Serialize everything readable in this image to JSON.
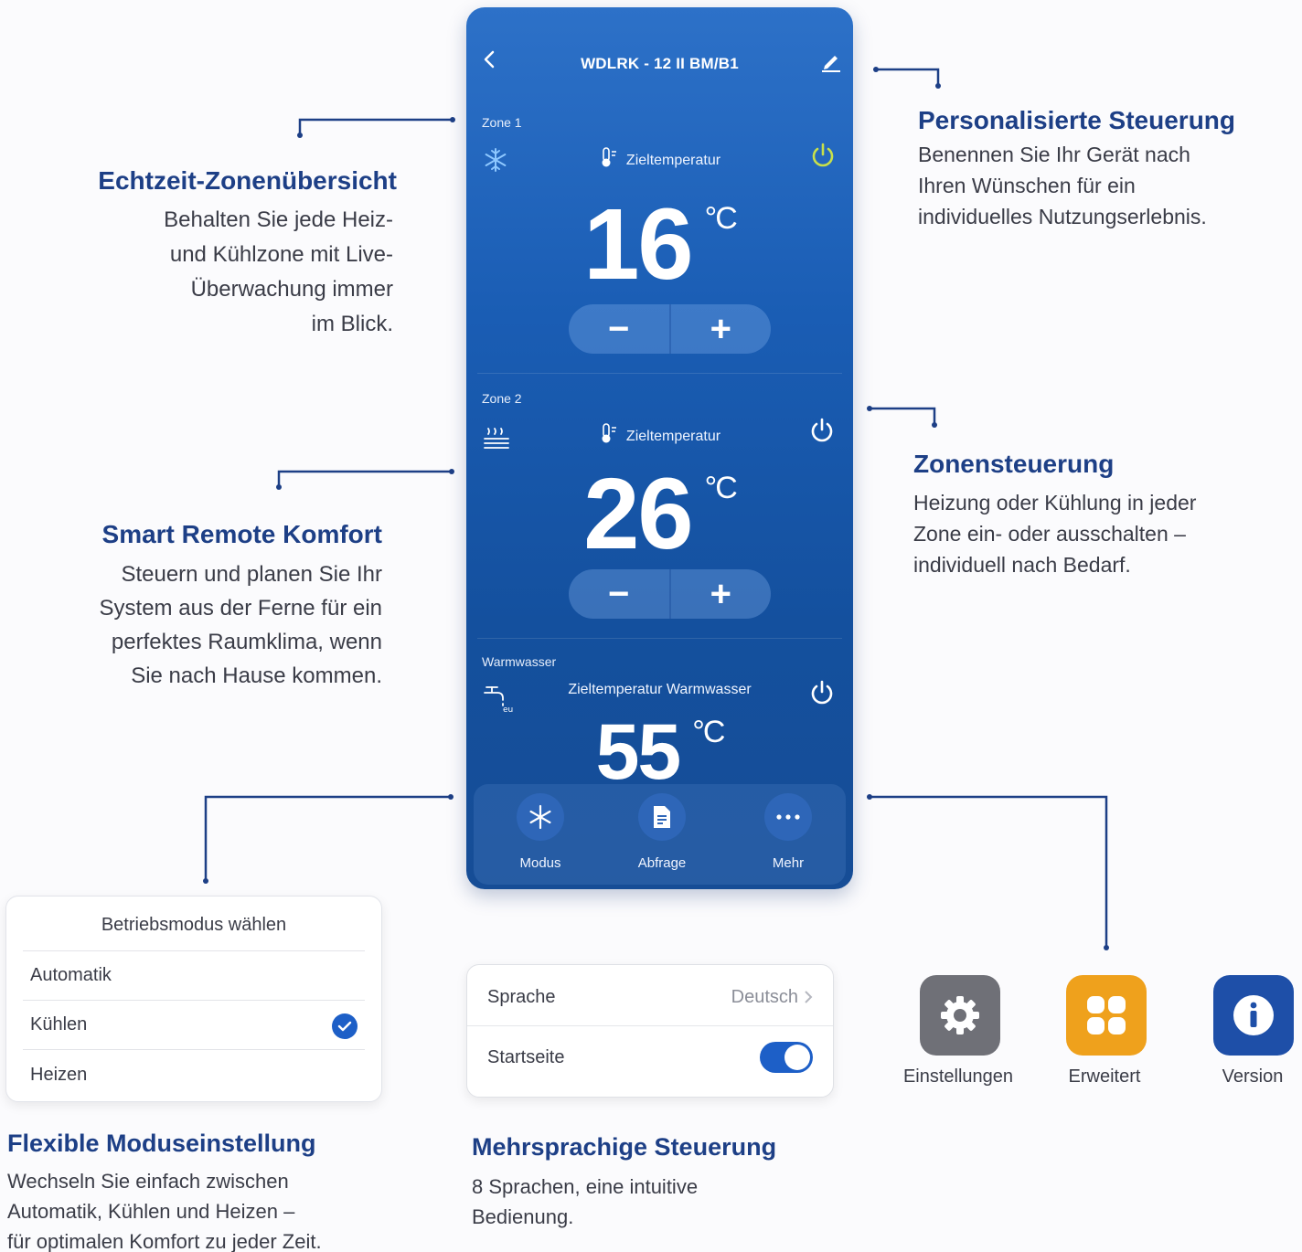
{
  "phone": {
    "title": "WDLRK - 12 II BM/B1",
    "zones": [
      {
        "label": "Zone 1",
        "target_label": "Zieltemperatur",
        "temperature": "16",
        "unit": "°C",
        "mode_icon": "snowflake-icon",
        "power_color": "#c8e04a"
      },
      {
        "label": "Zone 2",
        "target_label": "Zieltemperatur",
        "temperature": "26",
        "unit": "°C",
        "mode_icon": "heating-icon",
        "power_color": "#ffffff"
      },
      {
        "label": "Warmwasser",
        "target_label": "Zieltemperatur Warmwasser",
        "temperature": "55",
        "unit": "°C",
        "mode_icon": "faucet-icon",
        "power_color": "#ffffff"
      }
    ],
    "stepper": {
      "minus": "−",
      "plus": "+"
    },
    "nav": [
      {
        "label": "Modus",
        "icon": "snowflake-icon"
      },
      {
        "label": "Abfrage",
        "icon": "document-icon"
      },
      {
        "label": "Mehr",
        "icon": "more-icon"
      }
    ]
  },
  "callouts": {
    "personal": {
      "title": "Personalisierte Steuerung",
      "lines": [
        "Benennen Sie Ihr Gerät nach",
        "Ihren Wünschen für ein",
        "individuelles Nutzungserlebnis."
      ]
    },
    "zones_overview": {
      "title": "Echtzeit-Zonenübersicht",
      "lines": [
        "Behalten Sie jede Heiz-",
        "und Kühlzone mit Live-",
        "Überwachung immer",
        "im Blick."
      ]
    },
    "zone_control": {
      "title": "Zonensteuerung",
      "lines": [
        "Heizung oder Kühlung in jeder",
        "Zone ein- oder ausschalten –",
        "individuell nach Bedarf."
      ]
    },
    "remote": {
      "title": "Smart Remote Komfort",
      "lines": [
        "Steuern und planen Sie Ihr",
        "System aus der Ferne für ein",
        "perfektes Raumklima, wenn",
        "Sie nach Hause kommen."
      ]
    },
    "flexible": {
      "title": "Flexible Moduseinstellung",
      "lines": [
        "Wechseln Sie einfach zwischen",
        "Automatik, Kühlen und Heizen –",
        "für optimalen Komfort zu jeder Zeit."
      ]
    },
    "multilang": {
      "title": "Mehrsprachige Steuerung",
      "lines": [
        "8 Sprachen, eine intuitive",
        "Bedienung."
      ]
    }
  },
  "mode_card": {
    "title": "Betriebsmodus wählen",
    "options": [
      "Automatik",
      "Kühlen",
      "Heizen"
    ],
    "selected": "Kühlen"
  },
  "settings_card": {
    "language_label": "Sprache",
    "language_value": "Deutsch",
    "home_label": "Startseite",
    "home_enabled": true
  },
  "tiles": [
    {
      "label": "Einstellungen",
      "icon": "gear-icon",
      "color": "#6f7077"
    },
    {
      "label": "Erweitert",
      "icon": "grid-icon",
      "color": "#efa11c"
    },
    {
      "label": "Version",
      "icon": "info-icon",
      "color": "#1e4fa8"
    }
  ],
  "colors": {
    "accent": "#1d3f86",
    "toggle": "#1d5fc7"
  }
}
